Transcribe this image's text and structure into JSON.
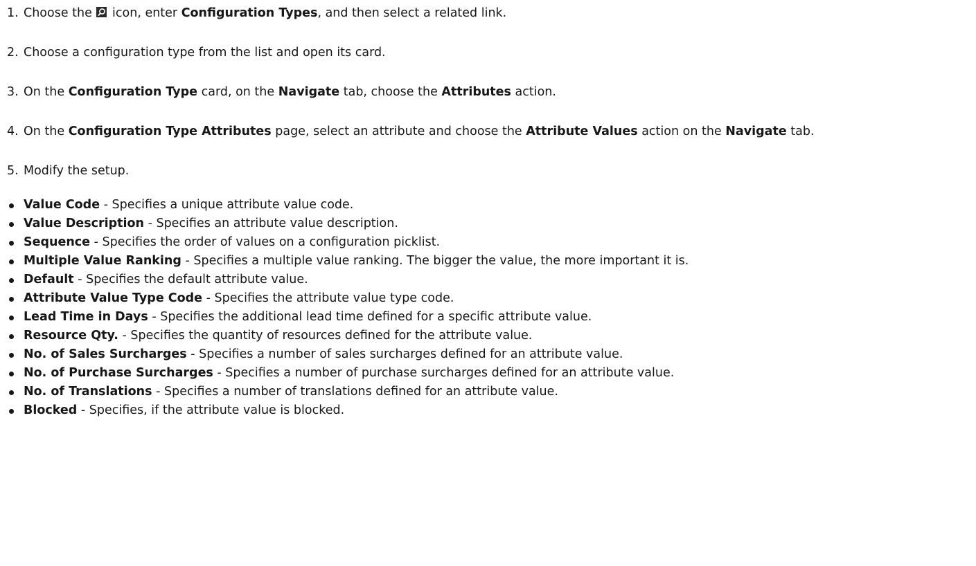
{
  "steps": [
    {
      "number": "1.",
      "parts": [
        "Choose the ",
        "icon, enter ",
        "Configuration Types",
        ", and then select a related link."
      ],
      "icon": "search-icon"
    },
    {
      "number": "2.",
      "parts": [
        "Choose a configuration type from the list and open its card."
      ]
    },
    {
      "number": "3.",
      "parts": [
        "On the ",
        "Configuration Type",
        " card, on the ",
        "Navigate",
        " tab, choose the ",
        "Attributes",
        " action."
      ]
    },
    {
      "number": "4.",
      "parts": [
        "On the ",
        "Configuration Type Attributes",
        " page, select an attribute and choose the ",
        "Attribute Values",
        " action on the ",
        "Navigate",
        " tab."
      ]
    },
    {
      "number": "5.",
      "parts": [
        "Modify the setup."
      ]
    }
  ],
  "fields": [
    {
      "name": "Value Code",
      "desc": " - Specifies a unique attribute value code."
    },
    {
      "name": "Value Description",
      "desc": " - Specifies an attribute value description."
    },
    {
      "name": "Sequence",
      "desc": " - Specifies the order of values on a configuration picklist."
    },
    {
      "name": "Multiple Value Ranking",
      "desc": " - Specifies a multiple value ranking. The bigger the value, the more important it is."
    },
    {
      "name": "Default",
      "desc": " - Specifies the default attribute value."
    },
    {
      "name": "Attribute Value Type Code",
      "desc": " - Specifies the attribute value type code."
    },
    {
      "name": "Lead Time in Days",
      "desc": " - Specifies the additional lead time defined for a specific attribute value."
    },
    {
      "name": "Resource Qty.",
      "desc": " - Specifies the quantity of resources defined for the attribute value."
    },
    {
      "name": "No. of Sales Surcharges",
      "desc": " - Specifies a number of sales surcharges defined for an attribute value."
    },
    {
      "name": "No. of Purchase Surcharges",
      "desc": " - Specifies a number of purchase surcharges defined for an attribute value."
    },
    {
      "name": "No. of Translations",
      "desc": " - Specifies a number of translations defined for an attribute value."
    },
    {
      "name": "Blocked",
      "desc": " - Specifies, if the attribute value is blocked."
    }
  ]
}
